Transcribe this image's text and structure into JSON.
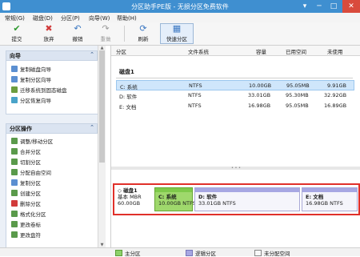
{
  "window": {
    "title": "分区助手PE版 - 无损分区免费软件",
    "controls": [
      "▾",
      "─",
      "□",
      "✕"
    ]
  },
  "menu": [
    "常规(G)",
    "磁盘(D)",
    "分区(P)",
    "向导(W)",
    "帮助(H)"
  ],
  "toolbar": {
    "buttons": [
      {
        "label": "提交",
        "icon": "✔",
        "color": "#2f9a2f"
      },
      {
        "label": "放弃",
        "icon": "✖",
        "color": "#d13b3b"
      },
      {
        "label": "撤销",
        "icon": "↶",
        "color": "#3c78c2"
      },
      {
        "label": "重做",
        "icon": "↷",
        "color": "#9a9a9a"
      },
      {
        "label": "刷新",
        "icon": "⟳",
        "color": "#3c78c2"
      },
      {
        "label": "快速分区",
        "icon": "▦",
        "color": "#3c78c2"
      }
    ]
  },
  "sidebar": {
    "wizard": {
      "title": "向导",
      "items": [
        "复制磁盘向导",
        "复制分区向导",
        "迁移系统到固态磁盘",
        "分区恢复向导"
      ]
    },
    "ops": {
      "title": "分区操作",
      "items": [
        "调整/移动分区",
        "合并分区",
        "切割分区",
        "分配自由空间",
        "复制分区",
        "创建分区",
        "删除分区",
        "格式化分区",
        "更改卷标",
        "更改盘符"
      ]
    }
  },
  "table": {
    "headers": [
      "分区",
      "文件系统",
      "容量",
      "已用空间",
      "未使用"
    ],
    "disk_label": "磁盘1",
    "rows": [
      {
        "name": "C: 系统",
        "fs": "NTFS",
        "cap": "10.00GB",
        "used": "95.05MB",
        "free": "9.91GB"
      },
      {
        "name": "D: 软件",
        "fs": "NTFS",
        "cap": "33.01GB",
        "used": "95.30MB",
        "free": "32.92GB"
      },
      {
        "name": "E: 文档",
        "fs": "NTFS",
        "cap": "16.98GB",
        "used": "95.05MB",
        "free": "16.89GB"
      }
    ]
  },
  "diskmap": {
    "disk": {
      "name": "磁盘1",
      "type": "基本 MBR",
      "size": "60.00GB"
    },
    "parts": [
      {
        "name": "C: 系统",
        "info": "10.00GB NTFS"
      },
      {
        "name": "D: 软件",
        "info": "33.01GB NTFS"
      },
      {
        "name": "E: 文档",
        "info": "16.98GB NTFS"
      }
    ]
  },
  "legend": [
    "主分区",
    "逻辑分区",
    "未分配空间"
  ],
  "colors": {
    "primary": "#8dd16a",
    "logical": "#a7a7e3",
    "unallocated": "#f7f7f7",
    "accent": "#e0302a",
    "title": "#3f8fd0"
  }
}
